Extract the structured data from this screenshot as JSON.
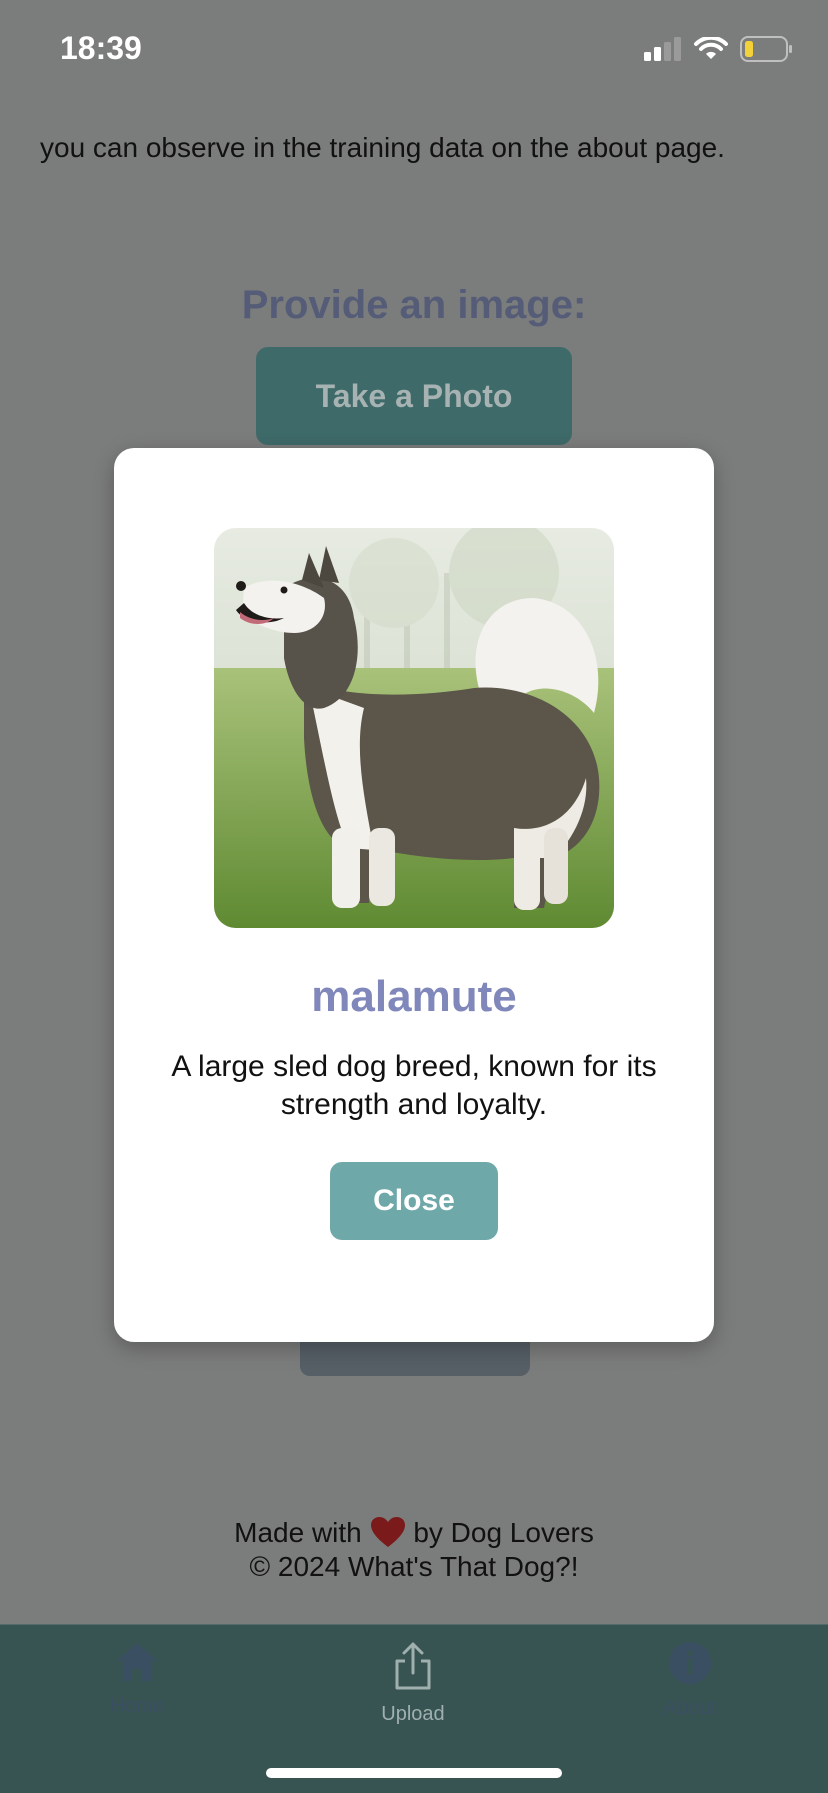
{
  "status_bar": {
    "time": "18:39"
  },
  "content": {
    "intro_text": "you can observe in the training data on the about page.",
    "provide_heading": "Provide an image:",
    "take_photo_label": "Take a Photo"
  },
  "footer": {
    "made_with_prefix": "Made with",
    "made_with_suffix": "by Dog Lovers",
    "copyright": "© 2024 What's That Dog?!"
  },
  "tab_bar": {
    "items": [
      {
        "label": "Home",
        "icon": "home-icon"
      },
      {
        "label": "Upload",
        "icon": "upload-icon"
      },
      {
        "label": "About",
        "icon": "info-icon"
      }
    ]
  },
  "modal": {
    "breed": "malamute",
    "description": "A large sled dog breed, known for its strength and loyalty.",
    "close_label": "Close"
  },
  "colors": {
    "accent": "#6fa8a9",
    "breed_text": "#8087bb",
    "tab_bar": "#375352",
    "overlay": "#7b7c7c"
  }
}
